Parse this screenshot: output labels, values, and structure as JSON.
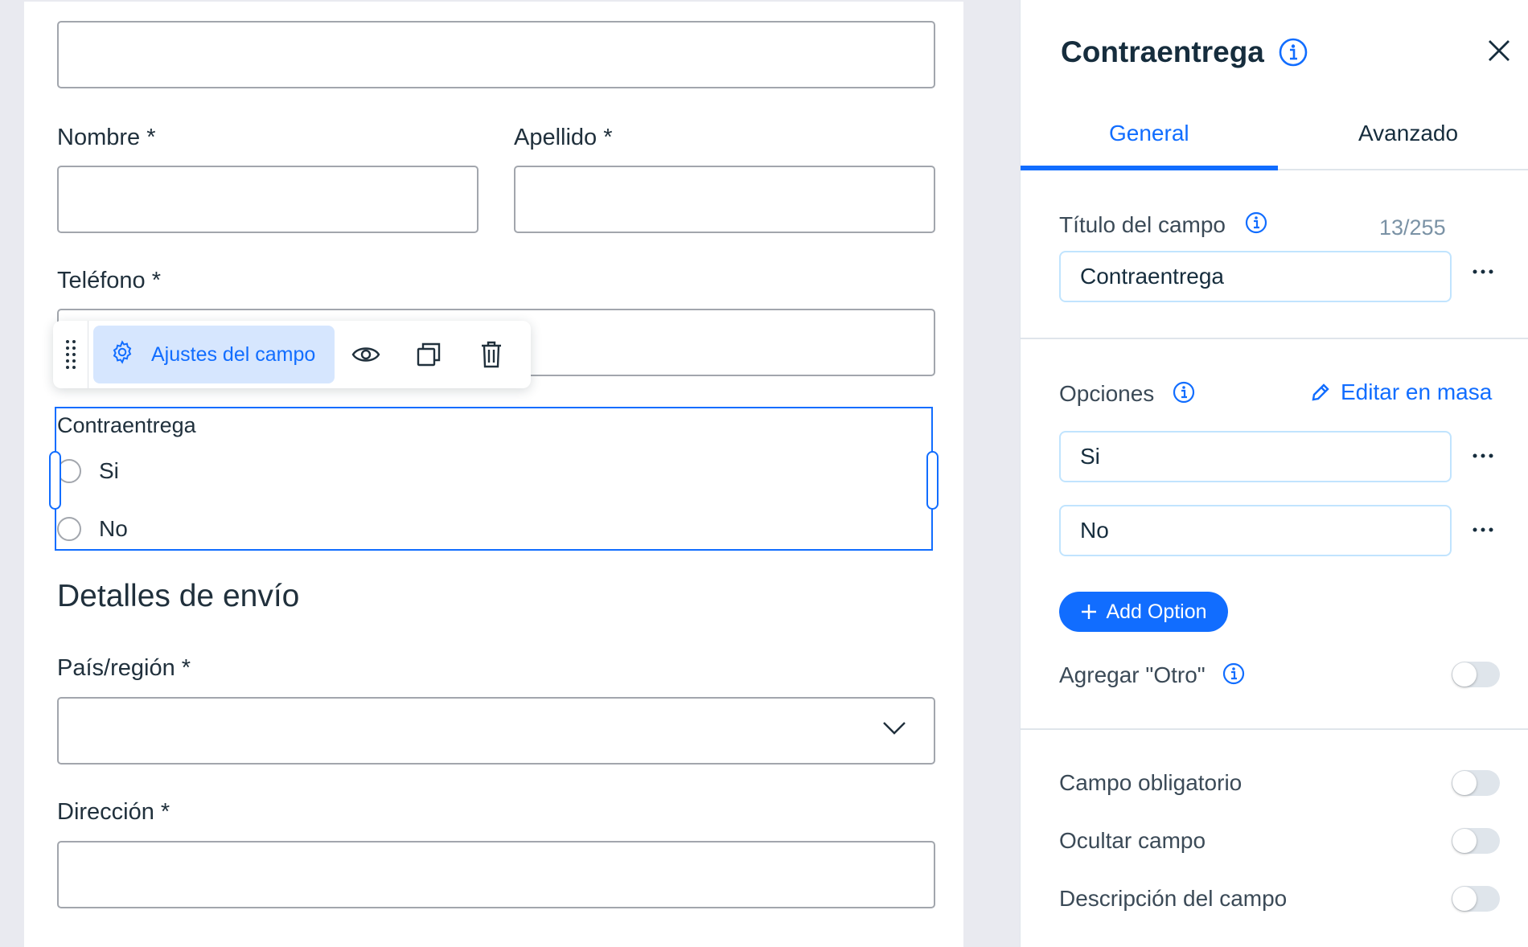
{
  "canvas": {
    "fields": {
      "first_name_label": "Nombre *",
      "last_name_label": "Apellido *",
      "phone_label": "Teléfono *",
      "country_label": "País/región *",
      "address_label": "Dirección *"
    },
    "toolbar": {
      "settings_label": "Ajustes del campo"
    },
    "selected_field": {
      "title": "Contraentrega",
      "options": [
        "Si",
        "No"
      ]
    },
    "section_title": "Detalles de envío"
  },
  "panel": {
    "title": "Contraentrega",
    "tabs": [
      "General",
      "Avanzado"
    ],
    "active_tab": "General",
    "field_title_label": "Título del campo",
    "field_title_counter": "13/255",
    "field_title_value": "Contraentrega",
    "options_label": "Opciones",
    "bulk_edit_label": "Editar en masa",
    "options": [
      "Si",
      "No"
    ],
    "add_option_label": "Add Option",
    "add_other_label": "Agregar \"Otro\"",
    "toggles": {
      "required_label": "Campo obligatorio",
      "hide_label": "Ocultar campo",
      "description_label": "Descripción del campo"
    },
    "toggle_states": {
      "add_other": false,
      "required": false,
      "hide": false,
      "description": false
    }
  },
  "colors": {
    "accent": "#116dff",
    "accent_light": "#d6e6fe",
    "input_border": "#a2a6ad",
    "panel_input_border": "#c1e4fe"
  },
  "icons": [
    "drag-handle-icon",
    "gear-icon",
    "eye-icon",
    "duplicate-icon",
    "trash-icon",
    "info-icon",
    "close-icon",
    "pencil-icon",
    "plus-icon",
    "more-icon",
    "chevron-down-icon"
  ]
}
